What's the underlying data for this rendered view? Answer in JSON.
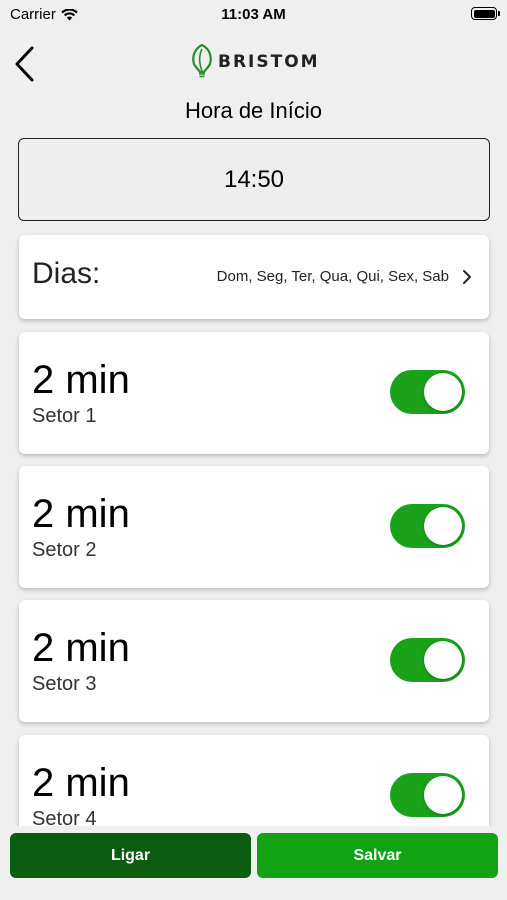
{
  "status_bar": {
    "carrier": "Carrier",
    "time": "11:03 AM"
  },
  "header": {
    "logo_text": "BRISTOM",
    "title": "Hora de Início"
  },
  "start_time": "14:50",
  "days": {
    "label": "Dias:",
    "value": "Dom, Seg, Ter, Qua, Qui, Sex, Sab"
  },
  "sectors": [
    {
      "duration": "2 min",
      "name": "Setor 1",
      "enabled": true
    },
    {
      "duration": "2 min",
      "name": "Setor 2",
      "enabled": true
    },
    {
      "duration": "2 min",
      "name": "Setor 3",
      "enabled": true
    },
    {
      "duration": "2 min",
      "name": "Setor 4",
      "enabled": true
    }
  ],
  "buttons": {
    "ligar": "Ligar",
    "salvar": "Salvar"
  },
  "colors": {
    "toggle_on": "#1aa31a",
    "ligar_bg": "#0b5c0e",
    "salvar_bg": "#11a313",
    "logo_green": "#2a8a2a"
  },
  "icons": {
    "back": "chevron-left-icon",
    "days": "chevron-right-icon",
    "wifi": "wifi-icon",
    "battery": "battery-icon"
  }
}
